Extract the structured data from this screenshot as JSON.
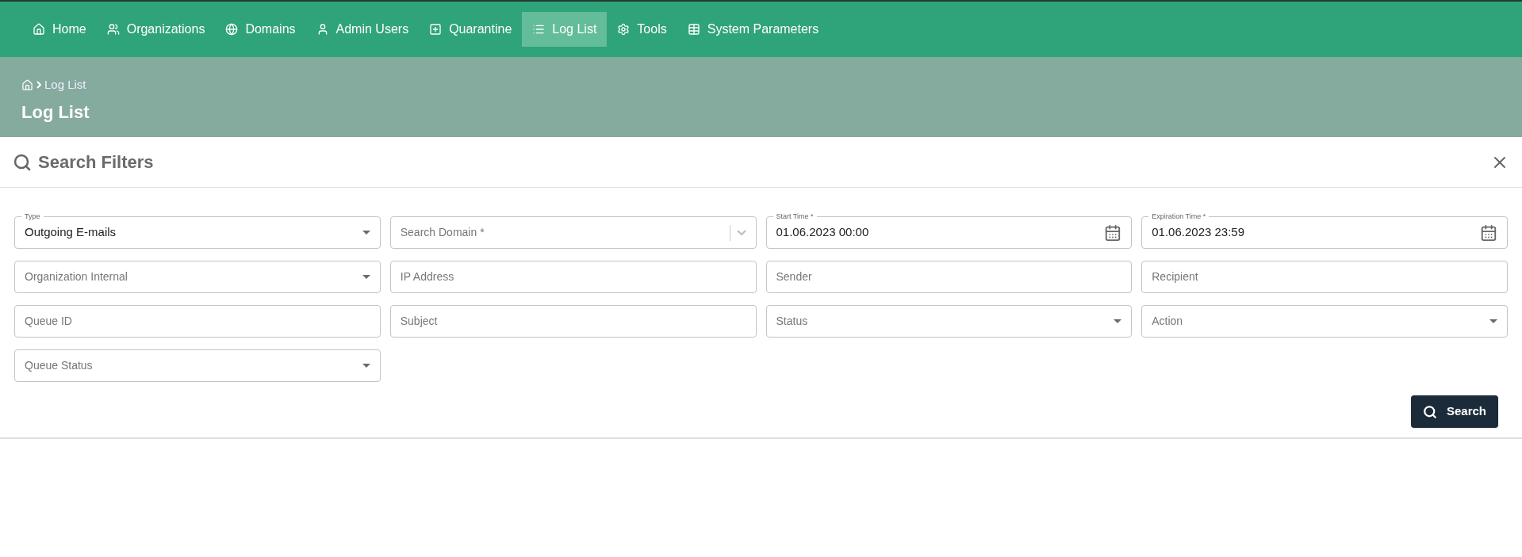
{
  "nav": [
    {
      "label": "Home",
      "selected": false
    },
    {
      "label": "Organizations",
      "selected": false
    },
    {
      "label": "Domains",
      "selected": false
    },
    {
      "label": "Admin Users",
      "selected": false
    },
    {
      "label": "Quarantine",
      "selected": false
    },
    {
      "label": "Log List",
      "selected": true
    },
    {
      "label": "Tools",
      "selected": false
    },
    {
      "label": "System Parameters",
      "selected": false
    }
  ],
  "breadcrumb": {
    "current": "Log List"
  },
  "page_title": "Log List",
  "filters": {
    "title": "Search Filters",
    "fields": [
      {
        "kind": "select",
        "label": "Type",
        "value": "Outgoing E-mails"
      },
      {
        "kind": "combo",
        "placeholder": "Search Domain *"
      },
      {
        "kind": "date",
        "label": "Start Time *",
        "value": "01.06.2023 00:00"
      },
      {
        "kind": "date",
        "label": "Expiration Time *",
        "value": "01.06.2023 23:59"
      },
      {
        "kind": "select",
        "placeholder": "Organization Internal"
      },
      {
        "kind": "text",
        "placeholder": "IP Address"
      },
      {
        "kind": "text",
        "placeholder": "Sender"
      },
      {
        "kind": "text",
        "placeholder": "Recipient"
      },
      {
        "kind": "text",
        "placeholder": "Queue ID"
      },
      {
        "kind": "text",
        "placeholder": "Subject"
      },
      {
        "kind": "select",
        "placeholder": "Status"
      },
      {
        "kind": "select",
        "placeholder": "Action"
      },
      {
        "kind": "select",
        "placeholder": "Queue Status"
      }
    ],
    "search_button": "Search"
  }
}
